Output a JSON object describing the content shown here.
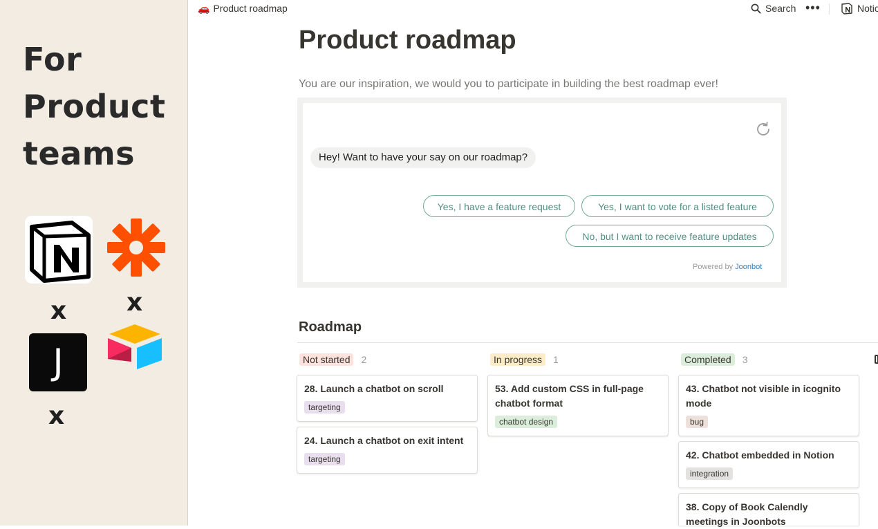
{
  "sidebar": {
    "hero_lines": [
      "For",
      "Product",
      "teams"
    ],
    "separator": "x",
    "j_letter": "J"
  },
  "topbar": {
    "breadcrumb": "Product roadmap",
    "search_label": "Search",
    "more_label": "•••",
    "notion_label": "Notion"
  },
  "page": {
    "title": "Product roadmap",
    "subtitle": "You are our inspiration, we would you to participate in building the best roadmap ever!"
  },
  "chatbot": {
    "greeting": "Hey! Want to have your say on our roadmap?",
    "options": [
      "Yes, I have a feature request",
      "Yes, I want to vote for a listed feature",
      "No, but I want to receive feature updates"
    ],
    "powered_by": "Powered by",
    "brand": "Joonbot"
  },
  "roadmap": {
    "title": "Roadmap",
    "columns": [
      {
        "name": "Not started",
        "count": "2",
        "color": "#ffe2dd",
        "cards": [
          {
            "title": "28. Launch a chatbot on scroll",
            "tag": "targeting",
            "tag_color": "#e8deee"
          },
          {
            "title": "24. Launch a chatbot on exit intent",
            "tag": "targeting",
            "tag_color": "#e8deee"
          }
        ]
      },
      {
        "name": "In progress",
        "count": "1",
        "color": "#fdecc8",
        "cards": [
          {
            "title": "53. Add custom CSS in full-page chatbot format",
            "tag": "chatbot design",
            "tag_color": "#dbeddb"
          }
        ]
      },
      {
        "name": "Completed",
        "count": "3",
        "color": "#dbeddb",
        "cards": [
          {
            "title": "43. Chatbot not visible in icognito mode",
            "tag": "bug",
            "tag_color": "#eee0da"
          },
          {
            "title": "42. Chatbot embedded in Notion",
            "tag": "integration",
            "tag_color": "#e3e2e0"
          },
          {
            "title": "38. Copy of Book Calendly meetings in Joonbots",
            "tag": "",
            "tag_color": ""
          }
        ]
      }
    ]
  },
  "colors": {
    "left_panel_bg": "#f3ece2",
    "chat_button_accent": "#4f8f81",
    "zapier_orange": "#ff4f00"
  }
}
